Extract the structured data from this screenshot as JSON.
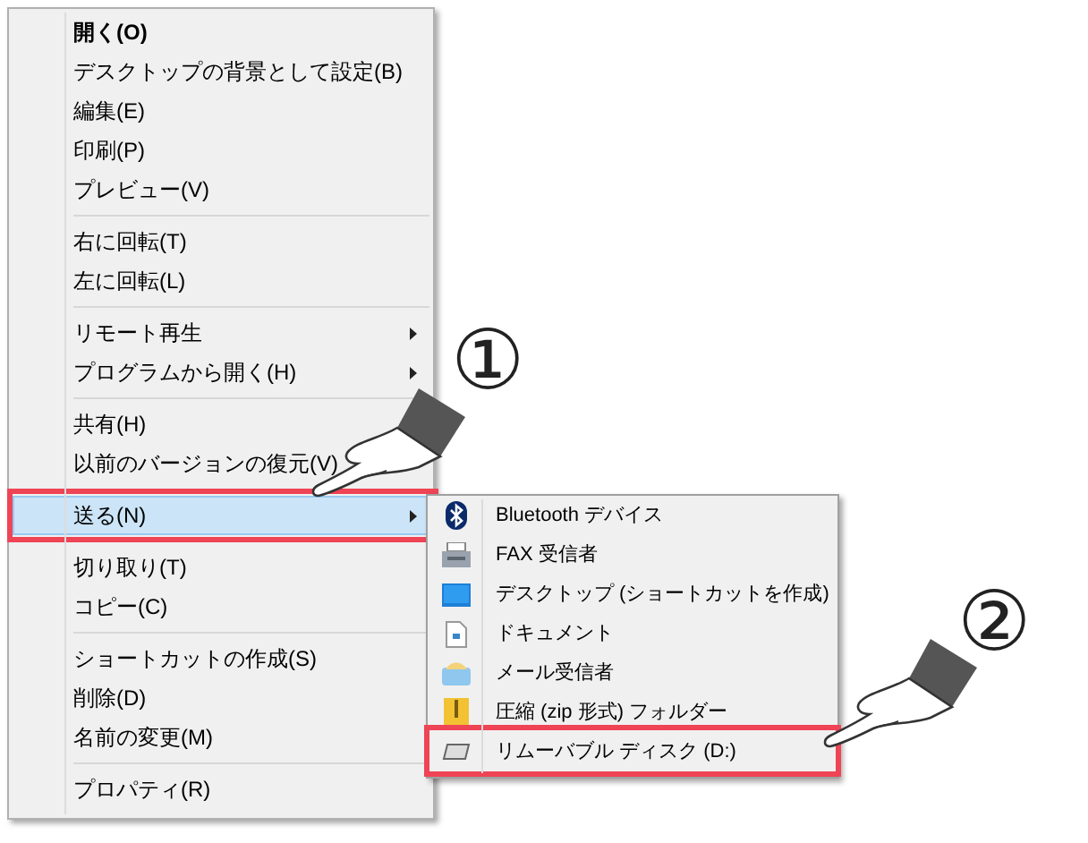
{
  "context_menu": {
    "items": [
      {
        "kind": "item",
        "label": "開く(O)",
        "bold": true
      },
      {
        "kind": "item",
        "label": "デスクトップの背景として設定(B)"
      },
      {
        "kind": "item",
        "label": "編集(E)"
      },
      {
        "kind": "item",
        "label": "印刷(P)"
      },
      {
        "kind": "item",
        "label": "プレビュー(V)"
      },
      {
        "kind": "separator"
      },
      {
        "kind": "item",
        "label": "右に回転(T)"
      },
      {
        "kind": "item",
        "label": "左に回転(L)"
      },
      {
        "kind": "separator"
      },
      {
        "kind": "item",
        "label": "リモート再生",
        "submenu": true
      },
      {
        "kind": "item",
        "label": "プログラムから開く(H)",
        "submenu": true
      },
      {
        "kind": "separator"
      },
      {
        "kind": "item",
        "label": "共有(H)"
      },
      {
        "kind": "item",
        "label": "以前のバージョンの復元(V)"
      },
      {
        "kind": "separator"
      },
      {
        "kind": "item",
        "label": "送る(N)",
        "submenu": true,
        "selected": true,
        "annotated": true
      },
      {
        "kind": "separator"
      },
      {
        "kind": "item",
        "label": "切り取り(T)"
      },
      {
        "kind": "item",
        "label": "コピー(C)"
      },
      {
        "kind": "separator"
      },
      {
        "kind": "item",
        "label": "ショートカットの作成(S)"
      },
      {
        "kind": "item",
        "label": "削除(D)"
      },
      {
        "kind": "item",
        "label": "名前の変更(M)"
      },
      {
        "kind": "separator"
      },
      {
        "kind": "item",
        "label": "プロパティ(R)"
      }
    ]
  },
  "send_to_menu": {
    "items": [
      {
        "label": "Bluetooth デバイス",
        "annotated": false
      },
      {
        "label": "FAX 受信者",
        "annotated": false
      },
      {
        "label": "デスクトップ (ショートカットを作成)",
        "annotated": false
      },
      {
        "label": "ドキュメント",
        "annotated": false
      },
      {
        "label": "メール受信者",
        "annotated": false
      },
      {
        "label": "圧縮 (zip 形式) フォルダー",
        "annotated": false
      },
      {
        "label": "リムーバブル ディスク (D:)",
        "annotated": true
      }
    ]
  },
  "step_markers": [
    "①",
    "②"
  ]
}
